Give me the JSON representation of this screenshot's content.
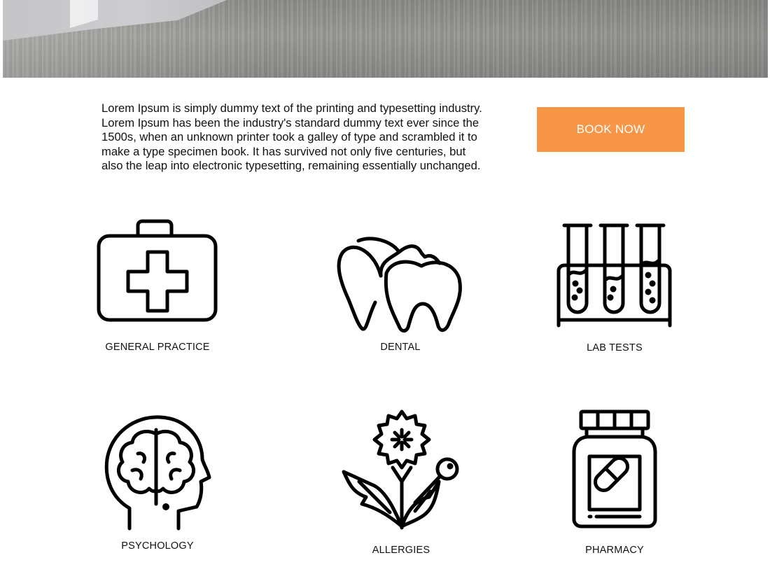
{
  "hero": {
    "image": "office-floor-photo"
  },
  "intro": {
    "text": "Lorem Ipsum is simply dummy text of the printing and typesetting industry. Lorem Ipsum has been the industry's standard dummy text ever since the 1500s, when an unknown printer took a galley of type and scrambled it to make a type specimen book. It has survived not only five centuries, but also the leap into electronic typesetting, remaining essentially unchanged."
  },
  "book_button": {
    "label": "BOOK NOW",
    "color": "#f79646"
  },
  "services": [
    {
      "label": "GENERAL PRACTICE",
      "icon": "first-aid-kit-icon"
    },
    {
      "label": "DENTAL",
      "icon": "teeth-icon"
    },
    {
      "label": "LAB TESTS",
      "icon": "test-tubes-icon"
    },
    {
      "label": "PSYCHOLOGY",
      "icon": "brain-head-icon"
    },
    {
      "label": "ALLERGIES",
      "icon": "dandelion-icon"
    },
    {
      "label": "PHARMACY",
      "icon": "pill-bottle-icon"
    }
  ]
}
